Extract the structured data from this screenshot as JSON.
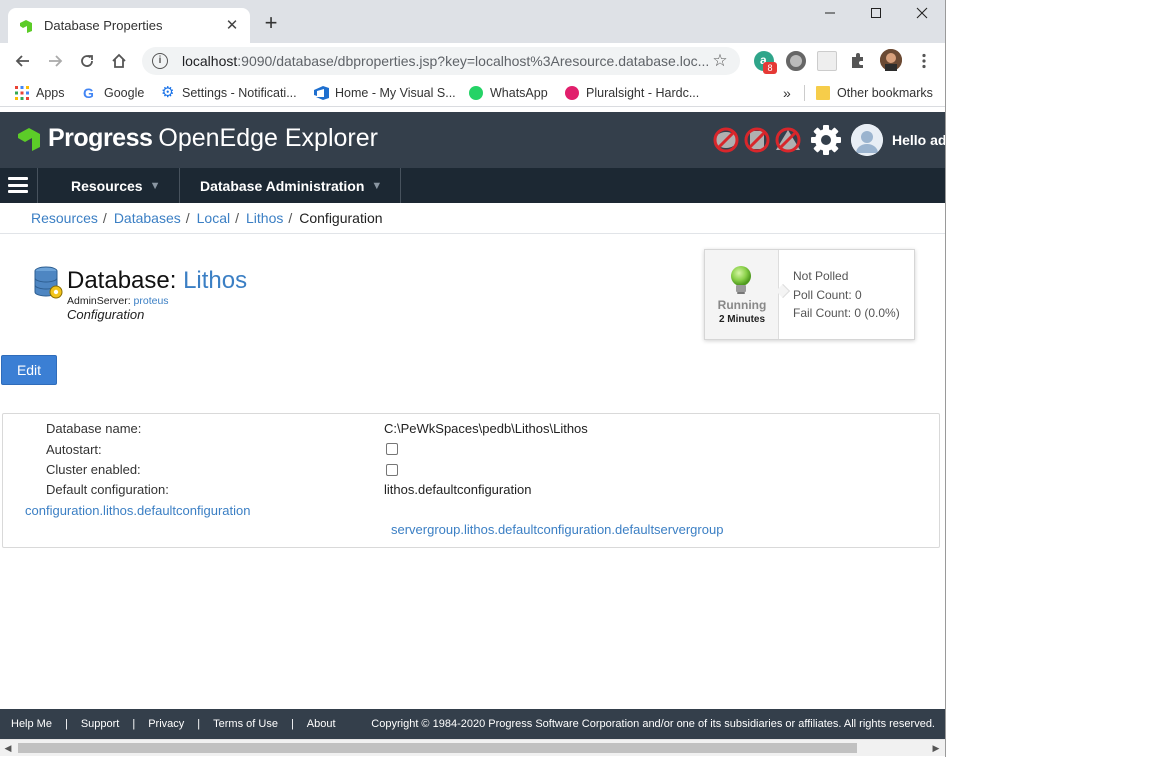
{
  "browser": {
    "tab_title": "Database Properties",
    "tab_close": "✕",
    "new_tab": "+",
    "window_controls": {
      "minimize": "—",
      "maximize": "☐",
      "close": "✕"
    },
    "url_host": "localhost",
    "url_rest": ":9090/database/dbproperties.jsp?key=localhost%3Aresource.database.loc...",
    "extension_badge": "8",
    "bookmarks": [
      "Apps",
      "Google",
      "Settings - Notificati...",
      "Home - My Visual S...",
      "WhatsApp",
      "Pluralsight - Hardc..."
    ],
    "bookmarks_overflow": "»",
    "other_bookmarks": "Other bookmarks"
  },
  "header": {
    "logo_brand": "Progress",
    "logo_product": "OpenEdge Explorer",
    "greeting": "Hello ad"
  },
  "nav": {
    "menus": [
      "Resources",
      "Database Administration"
    ],
    "caret": "▼"
  },
  "breadcrumb": {
    "items": [
      "Resources",
      "Databases",
      "Local",
      "Lithos"
    ],
    "separator": "/",
    "current": "Configuration"
  },
  "database": {
    "title_prefix": "Database: ",
    "name": "Lithos",
    "adminserver_label": "AdminServer: ",
    "adminserver_value": "proteus",
    "subtitle": "Configuration"
  },
  "status": {
    "state": "Running",
    "uptime": "2 Minutes",
    "poll_status": "Not Polled",
    "poll_count": "Poll Count: 0",
    "fail_count": "Fail Count: 0 (0.0%)"
  },
  "edit_label": "Edit",
  "properties": {
    "db_name_label": "Database name:",
    "db_name_value": "C:\\PeWkSpaces\\pedb\\Lithos\\Lithos",
    "autostart_label": "Autostart:",
    "autostart_checked": false,
    "cluster_label": "Cluster enabled:",
    "cluster_checked": false,
    "default_config_label": "Default configuration:",
    "default_config_value": "lithos.defaultconfiguration",
    "config_link": "configuration.lithos.defaultconfiguration",
    "servergroup_link": "servergroup.lithos.defaultconfiguration.defaultservergroup"
  },
  "footer": {
    "links": [
      "Help Me",
      "Support",
      "Privacy",
      "Terms of Use",
      "About"
    ],
    "separator": "|",
    "copyright": "Copyright © 1984-2020 Progress Software Corporation and/or one of its subsidiaries or affiliates. All rights reserved."
  },
  "colors": {
    "link": "#3b7fc4",
    "header_bg": "#343f4b",
    "nav_bg": "#1c2833",
    "edit_button": "#3b7fd4",
    "running_bulb": "#8bd14a"
  }
}
